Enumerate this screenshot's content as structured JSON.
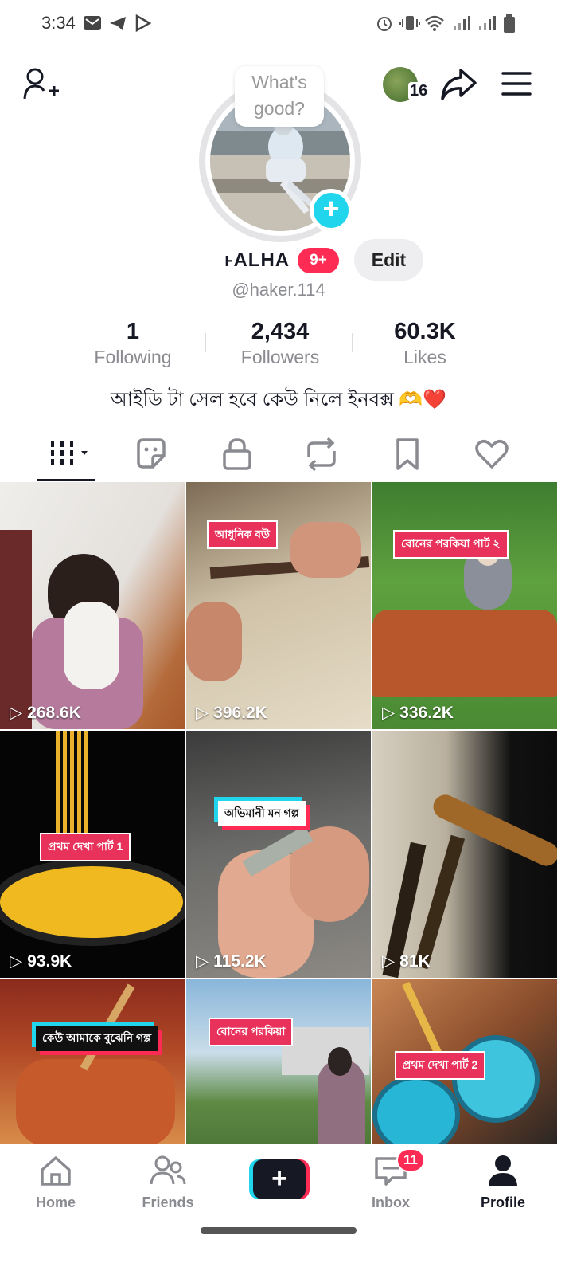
{
  "status": {
    "time": "3:34",
    "icons": [
      "mail-icon",
      "telegram-icon",
      "play-store-icon",
      "alarm-icon",
      "vibrate-icon",
      "wifi-icon",
      "signal-icon",
      "signal-icon",
      "battery-icon"
    ]
  },
  "topbar": {
    "follower_avatar_count": "16"
  },
  "profile": {
    "bubble_text_line1": "What's",
    "bubble_text_line2": "good?",
    "name": "ⱶALHA",
    "notif_badge": "9+",
    "edit_label": "Edit",
    "handle": "@haker.114",
    "bio": "আইডি টা সেল হবে কেউ নিলে ইনবক্স 🫶❤️"
  },
  "stats": [
    {
      "value": "1",
      "label": "Following"
    },
    {
      "value": "2,434",
      "label": "Followers"
    },
    {
      "value": "60.3K",
      "label": "Likes"
    }
  ],
  "tabs": [
    "videos-grid-icon",
    "favorites-sticker-icon",
    "private-lock-icon",
    "repost-icon",
    "bookmark-icon",
    "liked-heart-icon"
  ],
  "videos": [
    {
      "views": "268.6K",
      "caption": ""
    },
    {
      "views": "396.2K",
      "caption": "আধুনিক বউ"
    },
    {
      "views": "336.2K",
      "caption": "বোনের পরকিয়া পার্ট ২"
    },
    {
      "views": "93.9K",
      "caption": "প্রথম দেখা পার্ট 1"
    },
    {
      "views": "115.2K",
      "caption": "অভিমানী মন গল্প"
    },
    {
      "views": "81K",
      "caption": ""
    },
    {
      "views": "",
      "caption": "কেউ আমাকে বুঝেনি গল্প"
    },
    {
      "views": "",
      "caption": "বোনের পরকিয়া"
    },
    {
      "views": "",
      "caption": "প্রথম দেখা পার্ট 2"
    }
  ],
  "nav": {
    "home": "Home",
    "friends": "Friends",
    "inbox": "Inbox",
    "inbox_badge": "11",
    "profile": "Profile"
  },
  "colors": {
    "accent_red": "#fe2c55",
    "accent_cyan": "#20d5ec"
  }
}
